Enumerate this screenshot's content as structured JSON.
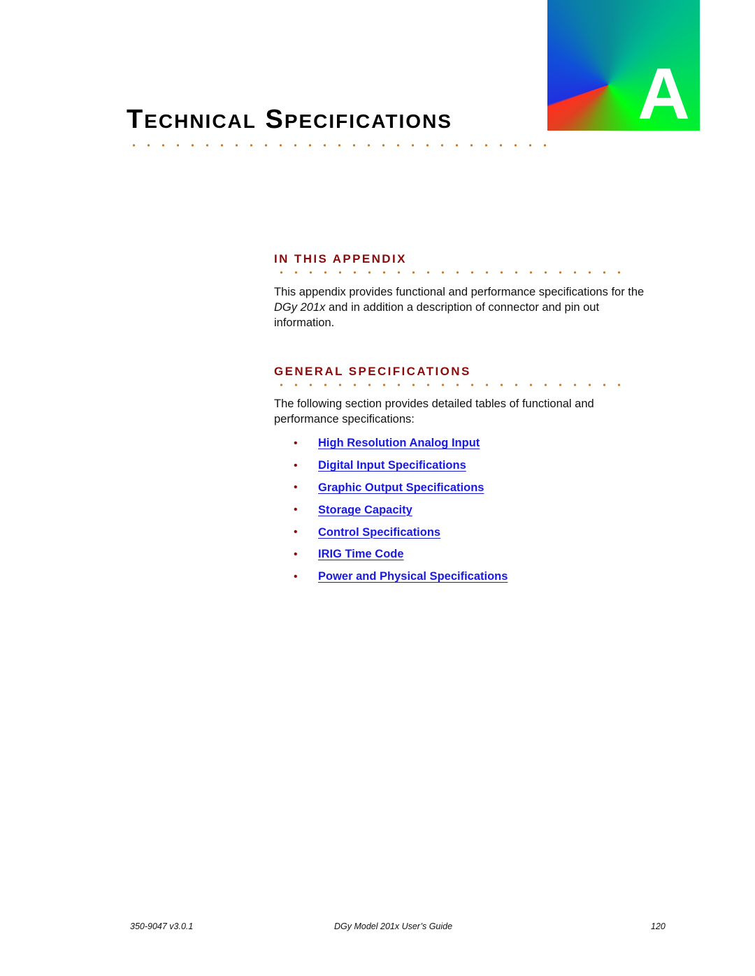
{
  "chapter": {
    "letter": "A",
    "title_first_letter_1": "T",
    "title_rest_1": "ECHNICAL",
    "title_first_letter_2": "S",
    "title_rest_2": "PECIFICATIONS"
  },
  "sections": {
    "appendix": {
      "heading": "IN THIS APPENDIX",
      "text_before": "This appendix provides functional and performance specifications for the ",
      "text_italic": "DGy 201x",
      "text_after": " and in addition a description of connector and pin out information."
    },
    "general": {
      "heading": "GENERAL SPECIFICATIONS",
      "text": "The following section provides detailed tables of functional and performance specifications:",
      "links": [
        {
          "label": "High Resolution Analog Input"
        },
        {
          "label": "Digital Input Specifications"
        },
        {
          "label": "Graphic Output Specifications"
        },
        {
          "label": "Storage Capacity"
        },
        {
          "label": "Control Specifications"
        },
        {
          "label": "IRIG Time Code"
        },
        {
          "label": "Power and Physical Specifications"
        }
      ],
      "bullet": "•"
    }
  },
  "footer": {
    "doc_number": "350-9047 v3.0.1",
    "doc_title": "DGy Model 201x User’s Guide",
    "page_number": "120"
  },
  "colors": {
    "heading": "#8b0a0a",
    "link": "#1a1adf",
    "dots": "#c87a2a"
  }
}
